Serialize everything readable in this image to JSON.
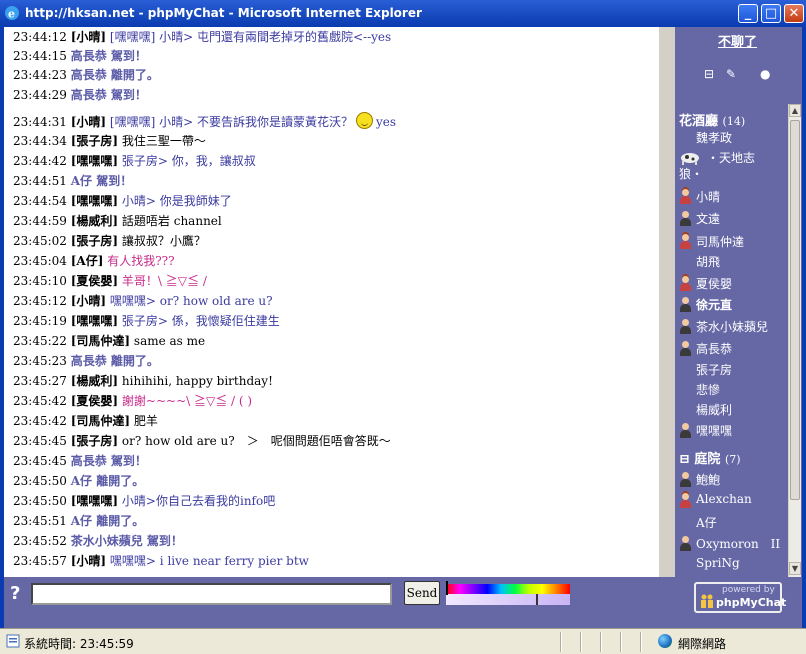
{
  "window": {
    "title": "http://hksan.net - phpMyChat - Microsoft Internet Explorer",
    "buttons": {
      "minimize": "_",
      "maximize": "□",
      "close": "✕"
    }
  },
  "messages": [
    {
      "time": "23:44:12",
      "nick": "[小晴]",
      "text": "[嘿嘿嘿] 小晴> 屯門還有兩間老掉牙的舊戲院<--yes",
      "style": "txt"
    },
    {
      "time": "23:44:15",
      "nick": "",
      "text": "高長恭 駕到！",
      "style": "sys"
    },
    {
      "time": "23:44:23",
      "nick": "",
      "text": "高長恭 離開了。",
      "style": "sys"
    },
    {
      "time": "23:44:29",
      "nick": "",
      "text": "高長恭 駕到！",
      "style": "sys"
    },
    {
      "time": "23:44:31",
      "nick": "[小晴]",
      "text": "[嘿嘿嘿] 小晴> 不要告訴我你是讀蒙黃花沃？",
      "extra": "yes",
      "style": "txt"
    },
    {
      "time": "23:44:34",
      "nick": "[張子房]",
      "text": "我住三聖一帶～",
      "style": "plain"
    },
    {
      "time": "23:44:42",
      "nick": "[嘿嘿嘿]",
      "text": "張子房> 你，我，讓叔叔",
      "style": "txt"
    },
    {
      "time": "23:44:51",
      "nick": "",
      "text": "A仔 駕到！",
      "style": "sys"
    },
    {
      "time": "23:44:54",
      "nick": "[嘿嘿嘿]",
      "text": "小晴> 你是我師妹了",
      "style": "txt"
    },
    {
      "time": "23:44:59",
      "nick": "[楊威利]",
      "text": "話題唔岩 channel",
      "style": "plain"
    },
    {
      "time": "23:45:02",
      "nick": "[張子房]",
      "text": "讓叔叔？小鷹？",
      "style": "plain"
    },
    {
      "time": "23:45:04",
      "nick": "[A仔]",
      "text": "有人找我???",
      "style": "pink"
    },
    {
      "time": "23:45:10",
      "nick": "[夏侯嬰]",
      "text": "羊哥！\\ ≧▽≦ /",
      "style": "pink"
    },
    {
      "time": "23:45:12",
      "nick": "[小晴]",
      "text": "嘿嘿嘿> or? how old are u?",
      "style": "txt"
    },
    {
      "time": "23:45:19",
      "nick": "[嘿嘿嘿]",
      "text": "張子房> 係，我懷疑佢住建生",
      "style": "txt"
    },
    {
      "time": "23:45:22",
      "nick": "[司馬仲達]",
      "text": "same as me",
      "style": "plain"
    },
    {
      "time": "23:45:23",
      "nick": "",
      "text": "高長恭 離開了。",
      "style": "sys"
    },
    {
      "time": "23:45:27",
      "nick": "[楊威利]",
      "text": "hihihihi, happy birthday!",
      "style": "plain"
    },
    {
      "time": "23:45:42",
      "nick": "[夏侯嬰]",
      "text": "謝謝~~~~\\ ≧▽≦ / ( )",
      "style": "pink"
    },
    {
      "time": "23:45:42",
      "nick": "[司馬仲達]",
      "text": "肥羊",
      "style": "plain"
    },
    {
      "time": "23:45:45",
      "nick": "[張子房]",
      "text": "or? how old are u?　＞　呢個問題佢唔會答既～",
      "style": "plain"
    },
    {
      "time": "23:45:45",
      "nick": "",
      "text": "高長恭 駕到！",
      "style": "sys"
    },
    {
      "time": "23:45:50",
      "nick": "",
      "text": "A仔 離開了。",
      "style": "sys"
    },
    {
      "time": "23:45:50",
      "nick": "[嘿嘿嘿]",
      "text": "小晴>你自己去看我的info吧",
      "style": "txt"
    },
    {
      "time": "23:45:51",
      "nick": "",
      "text": "A仔 離開了。",
      "style": "sys"
    },
    {
      "time": "23:45:52",
      "nick": "",
      "text": "茶水小妹蘋兒 駕到！",
      "style": "sys"
    },
    {
      "time": "23:45:57",
      "nick": "[小晴]",
      "text": "嘿嘿嘿> i live near ferry pier btw",
      "style": "txt"
    }
  ],
  "sidebar": {
    "not_chat": "不聊了",
    "tools": [
      "⊟",
      "✎",
      "●"
    ],
    "room1": {
      "name": "花酒廳",
      "count": "(14)"
    },
    "room1_users": [
      {
        "name": "魏孝政",
        "icon": ""
      },
      {
        "name": "・天地志狼・",
        "icon": "cow-icon"
      },
      {
        "name": "小晴",
        "icon": "female-user-icon"
      },
      {
        "name": "文遠",
        "icon": "male-user-icon"
      },
      {
        "name": "司馬仲達",
        "icon": "female-user-icon"
      },
      {
        "name": "胡飛",
        "icon": ""
      },
      {
        "name": "夏侯嬰",
        "icon": "female-user-icon"
      },
      {
        "name": "徐元直",
        "icon": "male-user-icon"
      },
      {
        "name": "茶水小妹蘋兒",
        "icon": "male-user-icon"
      },
      {
        "name": "高長恭",
        "icon": "male-user-icon"
      },
      {
        "name": "張子房",
        "icon": ""
      },
      {
        "name": "悲慘",
        "icon": ""
      },
      {
        "name": "楊威利",
        "icon": ""
      },
      {
        "name": "嘿嘿嘿",
        "icon": "male-user-icon"
      }
    ],
    "room2": {
      "name": "庭院",
      "count": "(7)"
    },
    "room2_users": [
      {
        "name": "鮑鮑",
        "icon": "male-user-icon"
      },
      {
        "name": "Alexchan",
        "icon": "female-user-icon"
      },
      {
        "name": "A仔",
        "icon": ""
      },
      {
        "name": "Oxymoron　II",
        "icon": "male-user-icon"
      },
      {
        "name": "SpriNg",
        "icon": ""
      }
    ]
  },
  "input": {
    "placeholder": "",
    "send_label": "Send",
    "help": "?"
  },
  "powered": {
    "line1": "powered by",
    "line2": "phpMyChat"
  },
  "status": {
    "left": "系統時間: 23:45:59",
    "zone": "網際網路"
  },
  "colors": {
    "panel": "#6668a6",
    "titlebar": "#1d4fc5",
    "nick_text": "#3a3aa0",
    "system": "#5b5ba8",
    "pink": "#c8288a"
  }
}
